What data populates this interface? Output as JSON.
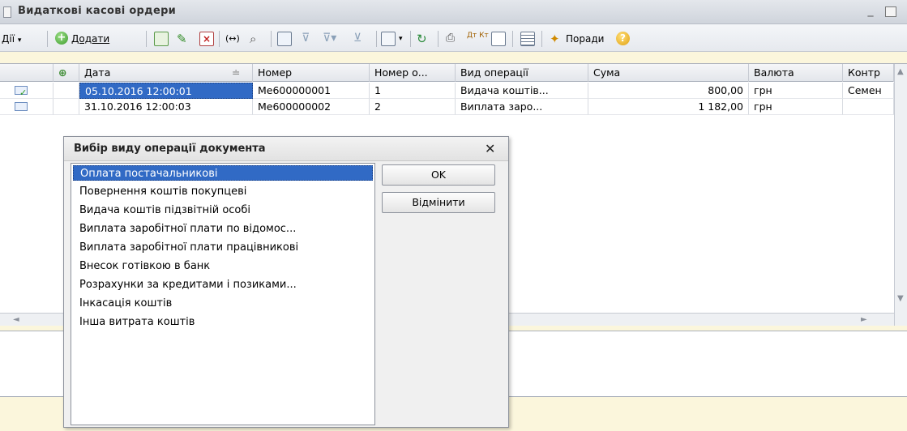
{
  "window": {
    "title": "Видаткові касові ордери"
  },
  "toolbar": {
    "actions_label": "Дії",
    "add_label": "Додати",
    "history_glyph": "(↔)",
    "tips_label": "Поради",
    "help_glyph": "?",
    "dt_kt_label": "Дт Кт"
  },
  "table": {
    "columns": [
      "Дата",
      "Номер",
      "Номер о...",
      "Вид операції",
      "Сума",
      "Валюта",
      "Контр"
    ],
    "rows": [
      {
        "date": "05.10.2016 12:00:01",
        "number": "Ме600000001",
        "in_number": "1",
        "operation": "Видача коштів...",
        "sum": "800,00",
        "currency": "грн",
        "contractor": "Семен"
      },
      {
        "date": "31.10.2016 12:00:03",
        "number": "Ме600000002",
        "in_number": "2",
        "operation": "Виплата заро...",
        "sum": "1 182,00",
        "currency": "грн",
        "contractor": ""
      }
    ]
  },
  "dialog": {
    "title": "Вибір виду операції документа",
    "items": [
      "Оплата постачальникові",
      "Повернення коштів покупцеві",
      "Видача коштів підзвітній особі",
      "Виплата заробітної плати по відомос...",
      "Виплата заробітної плати працівникові",
      "Внесок готівкою в банк",
      "Розрахунки за кредитами і позиками...",
      "Інкасація коштів",
      "Інша витрата коштів"
    ],
    "ok_label": "OK",
    "cancel_label": "Відмінити"
  },
  "colors": {
    "selection": "#316ac5",
    "background": "#fbf6dc"
  }
}
